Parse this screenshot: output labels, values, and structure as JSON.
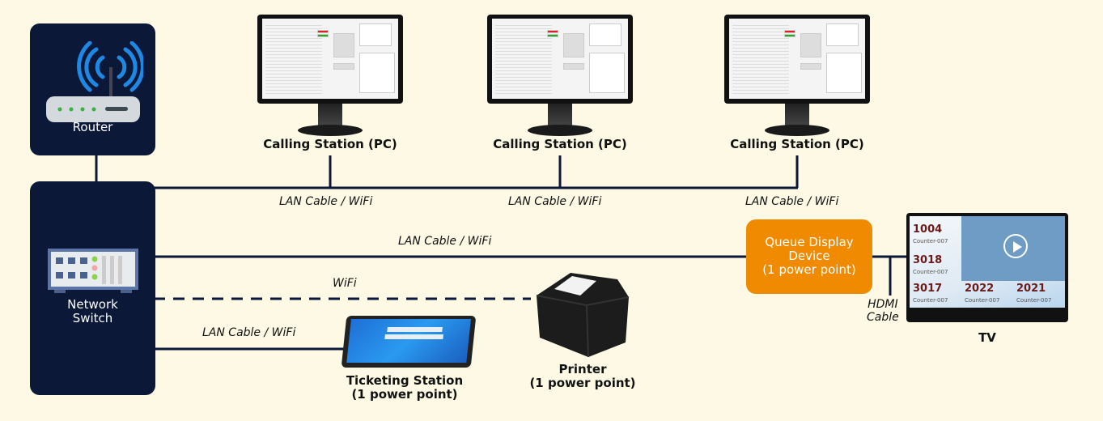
{
  "router": {
    "label": "Router"
  },
  "switch": {
    "label_line1": "Network",
    "label_line2": "Switch"
  },
  "stations": [
    {
      "label": "Calling Station (PC)",
      "cable": "LAN Cable / WiFi"
    },
    {
      "label": "Calling Station (PC)",
      "cable": "LAN Cable / WiFi"
    },
    {
      "label": "Calling Station (PC)",
      "cable": "LAN Cable / WiFi"
    }
  ],
  "queue_display": {
    "line1": "Queue Display",
    "line2": "Device",
    "line3": "(1 power point)",
    "cable": "LAN Cable / WiFi",
    "color": "#f08a00"
  },
  "printer": {
    "line1": "Printer",
    "line2": "(1 power point)",
    "cable": "WiFi"
  },
  "ticketing": {
    "line1": "Ticketing Station",
    "line2": "(1 power point)",
    "cable": "LAN Cable / WiFi"
  },
  "hdmi": {
    "line1": "HDMI",
    "line2": "Cable"
  },
  "tv": {
    "label": "TV",
    "screen": [
      {
        "num": "1004",
        "sub": "Counter-007"
      },
      {
        "num": "3018",
        "sub": "Counter-007"
      },
      {
        "num": "3017",
        "sub": "Counter-007"
      },
      {
        "num": "2022",
        "sub": "Counter-007"
      },
      {
        "num": "2021",
        "sub": "Counter-007"
      }
    ]
  },
  "colors": {
    "background": "#fdf9e4",
    "navy": "#0b1838",
    "line": "#0b1838",
    "wifi": "#1e88e5"
  }
}
